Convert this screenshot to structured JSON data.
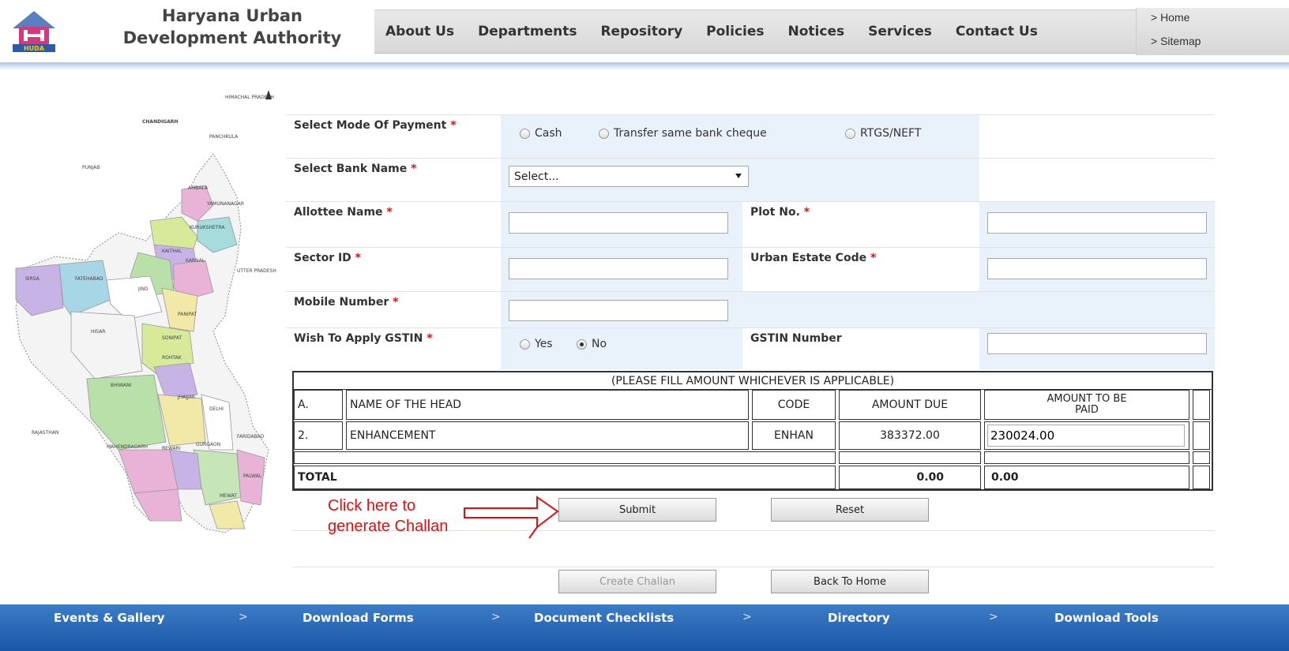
{
  "header": {
    "org_title_line1": "Haryana Urban",
    "org_title_line2": "Development Authority",
    "logo_text": "HUDA",
    "nav": [
      "About Us",
      "Departments",
      "Repository",
      "Policies",
      "Notices",
      "Services",
      "Contact Us"
    ],
    "quick_links": [
      "> Home",
      "> Sitemap"
    ]
  },
  "map_labels": [
    "HIMACHAL PRADESH",
    "CHANDIGARH",
    "PANCHKULA",
    "PUNJAB",
    "AMBALA",
    "YAMUNANAGAR",
    "KURUKSHETRA",
    "KAITHAL",
    "KARNAL",
    "SIRSA",
    "FATEHABAD",
    "UTTER PRADESH",
    "JIND",
    "PANIPAT",
    "HISAR",
    "SONIPAT",
    "ROHTAK",
    "BHIWANI",
    "JHAJJAR",
    "DELHI",
    "RAJASTHAN",
    "MAHENDRAGARH",
    "REWARI",
    "GURGAON",
    "FARIDABAD",
    "PALWAL",
    "MEWAT"
  ],
  "form": {
    "payment_mode_label": "Select Mode Of Payment",
    "payment_options": [
      "Cash",
      "Transfer same bank cheque",
      "RTGS/NEFT"
    ],
    "bank_label": "Select Bank Name",
    "bank_selected": "Select...",
    "allottee_label": "Allottee Name",
    "plot_label": "Plot No.",
    "sector_label": "Sector ID",
    "urban_estate_label": "Urban Estate Code",
    "mobile_label": "Mobile Number",
    "gstin_apply_label": "Wish To Apply GSTIN",
    "gstin_options": [
      "Yes",
      "No"
    ],
    "gstin_selected": "No",
    "gstin_number_label": "GSTIN Number",
    "required_mark": "*"
  },
  "table": {
    "caption": "(PLEASE FILL AMOUNT WHICHEVER IS APPLICABLE)",
    "headers": [
      "A.",
      "NAME OF THE HEAD",
      "CODE",
      "AMOUNT DUE",
      "AMOUNT TO BE PAID"
    ],
    "rows": [
      {
        "no": "2.",
        "head": "ENHANCEMENT",
        "code": "ENHAN",
        "amount_due": "383372.00",
        "amount_to_pay": "230024.00"
      }
    ],
    "total_label": "TOTAL",
    "total_due": "0.00",
    "total_paid": "0.00"
  },
  "buttons": {
    "submit": "Submit",
    "reset": "Reset",
    "create_challan": "Create Challan",
    "back_home": "Back To Home"
  },
  "annotation": {
    "line1": "Click here to",
    "line2": "generate Challan",
    "color": "#e01010"
  },
  "footer": [
    "Events & Gallery",
    "Download Forms",
    "Document Checklists",
    "Directory",
    "Download Tools"
  ],
  "footer_sep": ">"
}
